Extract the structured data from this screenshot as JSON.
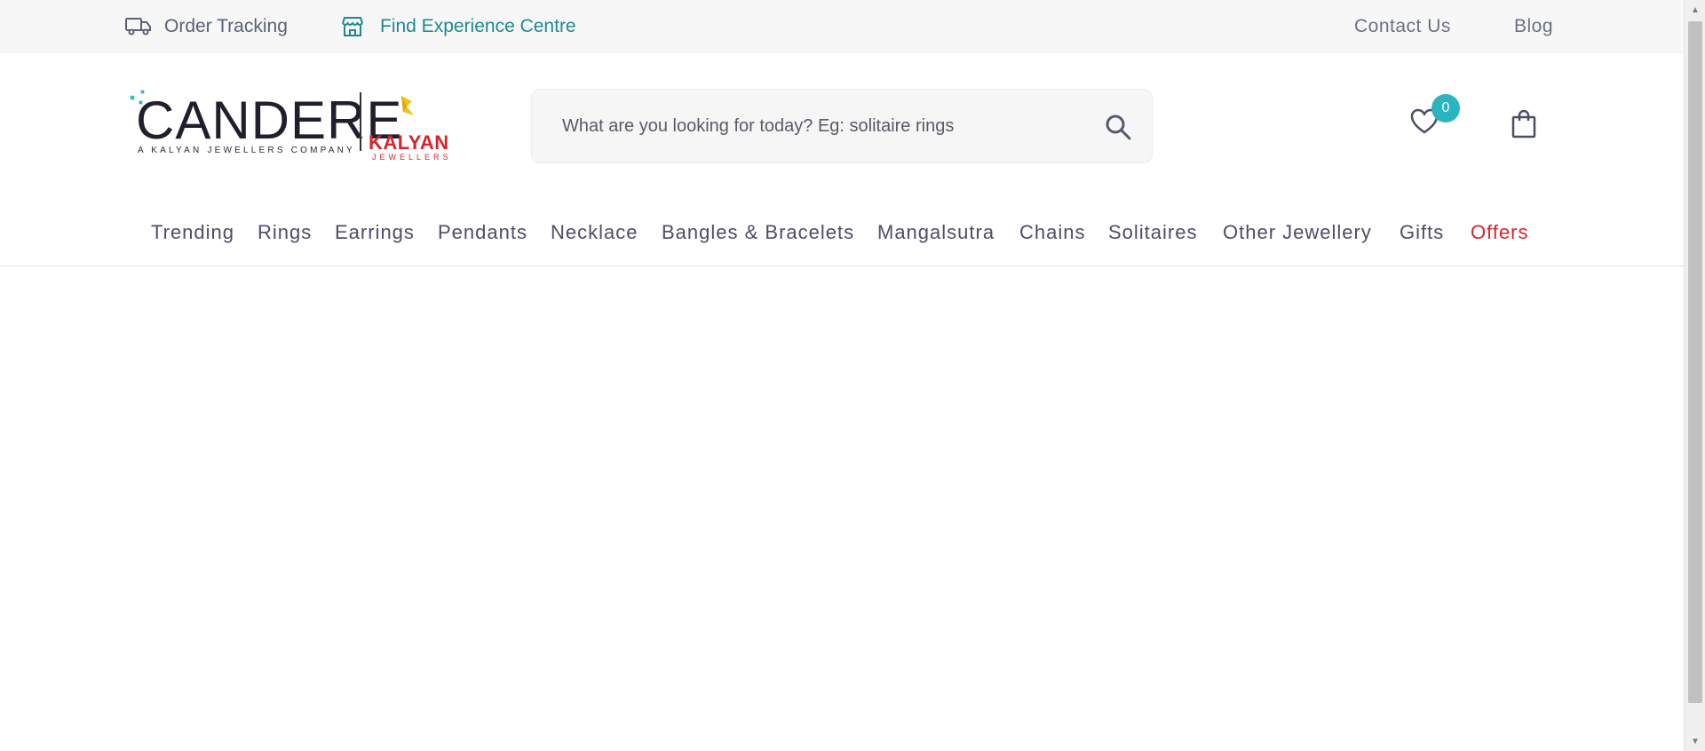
{
  "topbar": {
    "order_tracking": "Order Tracking",
    "find_centre": "Find Experience Centre",
    "contact_us": "Contact Us",
    "blog": "Blog"
  },
  "logo": {
    "brand": "CANDERE",
    "subtitle": "A KALYAN JEWELLERS COMPANY",
    "partner": "KALYAN",
    "partner_sub": "JEWELLERS"
  },
  "search": {
    "placeholder": "What are you looking for today? Eg: solitaire rings"
  },
  "wishlist": {
    "count": "0"
  },
  "nav": {
    "items": [
      "Trending",
      "Rings",
      "Earrings",
      "Pendants",
      "Necklace",
      "Bangles & Bracelets",
      "Mangalsutra",
      "Chains",
      "Solitaires",
      "Other Jewellery",
      "Gifts",
      "Offers"
    ]
  },
  "colors": {
    "accent": "#2bb3c0",
    "teal_link": "#1b8a92",
    "offers": "#d8242c",
    "topbar_bg": "#f7f7f7"
  },
  "icons": {
    "order_tracking": "truck-icon",
    "find_centre": "store-icon",
    "search": "search-icon",
    "wishlist": "heart-icon",
    "cart": "shopping-bag-icon"
  }
}
